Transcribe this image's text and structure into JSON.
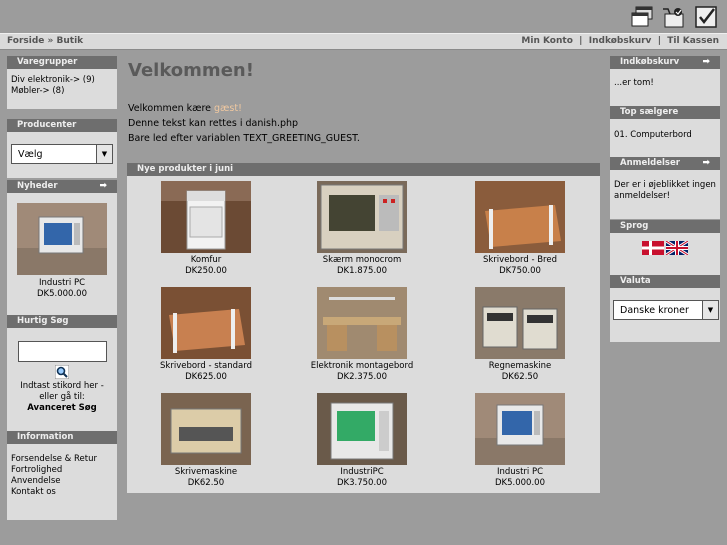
{
  "navbar": {
    "crumbs": [
      "Forside",
      "Butik"
    ],
    "separator": "»",
    "links": [
      "Min Konto",
      "Indkøbskurv",
      "Til Kassen"
    ],
    "link_separator": "|"
  },
  "left": {
    "categories": {
      "title": "Varegrupper",
      "items": [
        "Div elektronik-> (9)",
        "Møbler-> (8)"
      ]
    },
    "manufacturers": {
      "title": "Producenter",
      "select_value": "Vælg"
    },
    "news": {
      "title": "Nyheder",
      "product_name": "Industri PC",
      "product_price": "DK5.000.00"
    },
    "quicksearch": {
      "title": "Hurtig Søg",
      "help_text": "Indtast stikord her - eller gå til:",
      "advanced_link": "Avanceret Søg"
    },
    "information": {
      "title": "Information",
      "links": [
        "Forsendelse & Retur",
        "Fortrolighed",
        "Anvendelse",
        "Kontakt os"
      ]
    }
  },
  "main": {
    "heading": "Velkommen!",
    "greeting_prefix": "Velkommen kære",
    "greeting_guest": "gæst!",
    "line2": "Denne tekst kan rettes i danish.php",
    "line3": "Bare led efter variablen TEXT_GREETING_GUEST.",
    "new_products": {
      "title": "Nye produkter i juni",
      "items": [
        {
          "name": "Komfur",
          "price": "DK250.00"
        },
        {
          "name": "Skærm monocrom",
          "price": "DK1.875.00"
        },
        {
          "name": "Skrivebord - Bred",
          "price": "DK750.00"
        },
        {
          "name": "Skrivebord - standard",
          "price": "DK625.00"
        },
        {
          "name": "Elektronik montagebord",
          "price": "DK2.375.00"
        },
        {
          "name": "Regnemaskine",
          "price": "DK62.50"
        },
        {
          "name": "Skrivemaskine",
          "price": "DK62.50"
        },
        {
          "name": "IndustriPC",
          "price": "DK3.750.00"
        },
        {
          "name": "Industri PC",
          "price": "DK5.000.00"
        }
      ]
    }
  },
  "right": {
    "cart": {
      "title": "Indkøbskurv",
      "text": "...er tom!"
    },
    "bestsellers": {
      "title": "Top sælgere",
      "item": "01.  Computerbord"
    },
    "reviews": {
      "title": "Anmeldelser",
      "text": "Der er i øjeblikket ingen anmeldelser!"
    },
    "languages": {
      "title": "Sprog"
    },
    "currencies": {
      "title": "Valuta",
      "select_value": "Danske kroner"
    }
  },
  "icons": [
    "windows-icon",
    "cart-icon",
    "checkout-icon",
    "arrow-right-icon",
    "search-icon",
    "danish-flag-icon",
    "uk-flag-icon"
  ]
}
